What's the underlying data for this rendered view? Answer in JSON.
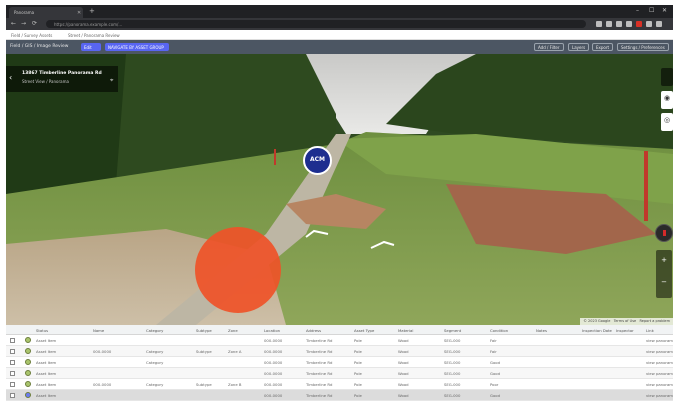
{
  "browser": {
    "tab_title": "Panorama",
    "tab_close": "✕",
    "new_tab": "+",
    "url": "https://panorama.example.com/...",
    "nav": {
      "back": "←",
      "forward": "→",
      "reload": "⟳"
    },
    "window_controls": {
      "minimize": "–",
      "maximize": "☐",
      "close": "✕"
    },
    "extension_colors": [
      "#bdbdbd",
      "#bdbdbd",
      "#bdbdbd",
      "#bdbdbd",
      "#d93025",
      "#bdbdbd",
      "#bdbdbd"
    ]
  },
  "breadcrumbs": [
    "Field / Survey Assets",
    "Street / Panorama Review"
  ],
  "toolbar": {
    "title": "Field / GIS / Image Review",
    "chip_small": "Edit",
    "chip_wide": "NAVIGATE BY ASSET GROUP",
    "buttons": [
      "Add / Filter",
      "Layers",
      "Export",
      "Settings / Preferences"
    ],
    "accent_color": "#5865f2"
  },
  "panorama": {
    "address_title": "13867 Timberline Panorama Rd",
    "address_subtitle": "Street View / Panorama",
    "back_icon": "‹",
    "badge_label": "ACM",
    "badge_color": "#1d2e8f",
    "marker_color": "#ef5228",
    "side_buttons": [
      "◉",
      "◎"
    ],
    "zoom": {
      "plus": "+",
      "minus": "−"
    },
    "footer": [
      "© 2023 Google",
      "Terms of Use",
      "Report a problem"
    ]
  },
  "table": {
    "headers": [
      "Status",
      "Name",
      "Category",
      "Subtype",
      "Zone",
      "Location",
      "Address",
      "Asset Type",
      "Material",
      "Segment",
      "Condition",
      "Notes",
      "Inspection Date",
      "Inspector",
      "Link"
    ],
    "status_colors": [
      "#a9c46c",
      "#a9c46c",
      "#a9c46c",
      "#a9c46c",
      "#a9c46c",
      "#6c7cf0"
    ],
    "rows": [
      [
        "Asset Item",
        "",
        "",
        "",
        "",
        "000-0000",
        "Timberline Rd",
        "Pole",
        "Wood",
        "SEG-000",
        "Fair",
        "",
        "",
        "",
        "view panorama"
      ],
      [
        "Asset Item",
        "000-0000",
        "Category",
        "Subtype",
        "Zone A",
        "000-0000",
        "Timberline Rd",
        "Pole",
        "Wood",
        "SEG-000",
        "Fair",
        "",
        "",
        "",
        "view panorama"
      ],
      [
        "Asset Item",
        "",
        "Category",
        "",
        "",
        "000-0000",
        "Timberline Rd",
        "Pole",
        "Wood",
        "SEG-000",
        "Good",
        "",
        "",
        "",
        "view panorama"
      ],
      [
        "Asset Item",
        "",
        "",
        "",
        "",
        "000-0000",
        "Timberline Rd",
        "Pole",
        "Wood",
        "SEG-000",
        "Good",
        "",
        "",
        "",
        "view panorama"
      ],
      [
        "Asset Item",
        "000-0000",
        "Category",
        "Subtype",
        "Zone B",
        "000-0000",
        "Timberline Rd",
        "Pole",
        "Wood",
        "SEG-000",
        "Poor",
        "",
        "",
        "",
        "view panorama"
      ],
      [
        "Asset Item",
        "",
        "",
        "",
        "",
        "000-0000",
        "Timberline Rd",
        "Pole",
        "Wood",
        "SEG-000",
        "Good",
        "",
        "",
        "",
        "view panorama"
      ]
    ]
  }
}
